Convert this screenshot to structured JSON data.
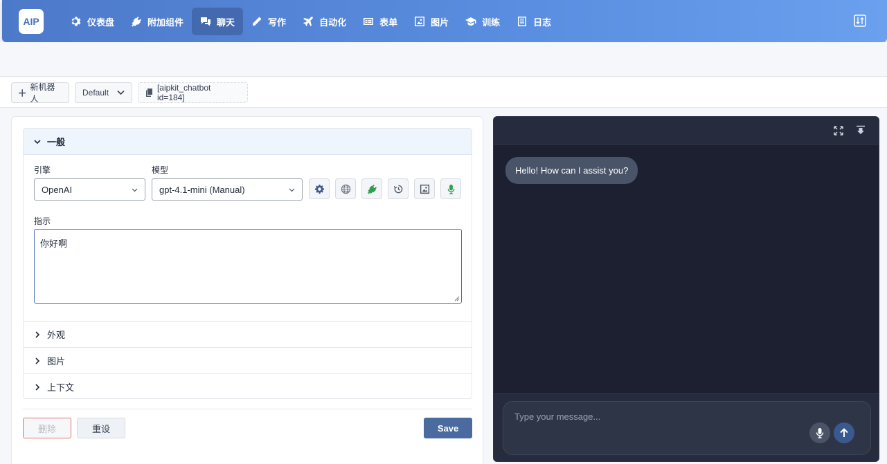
{
  "app": {
    "logo": "AIP",
    "nav": [
      {
        "label": "仪表盘",
        "icon": "gear-icon"
      },
      {
        "label": "附加组件",
        "icon": "plug-icon"
      },
      {
        "label": "聊天",
        "icon": "chat-icon",
        "active": true
      },
      {
        "label": "写作",
        "icon": "pencil-icon"
      },
      {
        "label": "自动化",
        "icon": "plane-icon"
      },
      {
        "label": "表单",
        "icon": "form-icon"
      },
      {
        "label": "图片",
        "icon": "image-icon"
      },
      {
        "label": "训练",
        "icon": "graduation-cap-icon"
      },
      {
        "label": "日志",
        "icon": "log-icon"
      }
    ]
  },
  "toolbar": {
    "new_bot": "新机器人",
    "bot_select": "Default",
    "shortcode": "[aipkit_chatbot id=184]"
  },
  "settings": {
    "general_title": "一般",
    "engine_label": "引擎",
    "engine_value": "OpenAI",
    "model_label": "模型",
    "model_value": "gpt-4.1-mini (Manual)",
    "instructions_label": "指示",
    "instructions_value": "你好啊",
    "sections": [
      "外观",
      "图片",
      "上下文"
    ],
    "delete_label": "删除",
    "reset_label": "重设",
    "save_label": "Save"
  },
  "chat": {
    "greeting": "Hello! How can I assist you?",
    "input_placeholder": "Type your message..."
  },
  "colors": {
    "nav_gradient_start": "#4d79c9",
    "nav_gradient_end": "#6aa0ee",
    "save_button": "#4a6aa0",
    "chat_background": "#1c2030",
    "delete_border": "#e07070"
  }
}
